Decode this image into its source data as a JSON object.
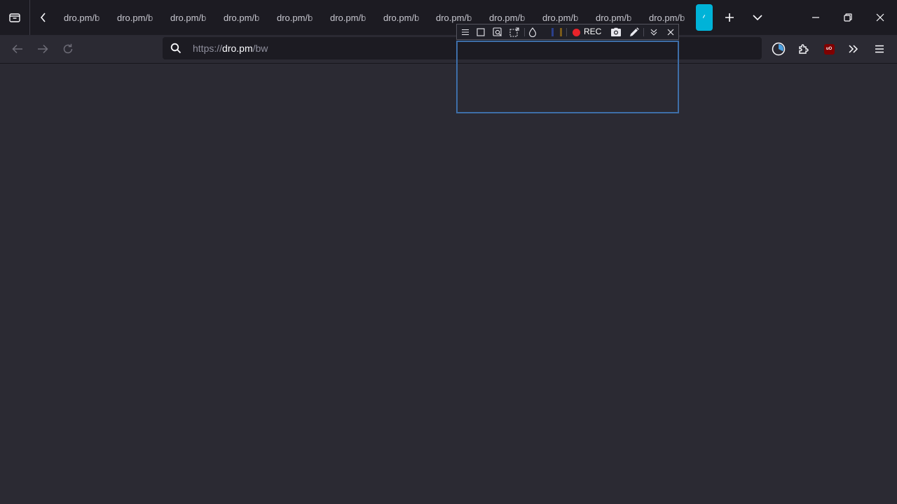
{
  "tabs": [
    {
      "label": "dro.pm/b"
    },
    {
      "label": "dro.pm/b"
    },
    {
      "label": "dro.pm/b"
    },
    {
      "label": "dro.pm/b"
    },
    {
      "label": "dro.pm/b"
    },
    {
      "label": "dro.pm/b"
    },
    {
      "label": "dro.pm/b"
    },
    {
      "label": "dro.pm/b"
    },
    {
      "label": "dro.pm/b"
    },
    {
      "label": "dro.pm/b"
    },
    {
      "label": "dro.pm/b"
    },
    {
      "label": "dro.pm/b"
    }
  ],
  "urlbar": {
    "scheme": "https://",
    "host": "dro.pm",
    "path": "/bw"
  },
  "extensions": {
    "ublock_badge": "uO"
  },
  "capture_toolbar": {
    "rec_label": "REC",
    "rec_color": "#e8232a",
    "swatches": [
      "#2a3f8a",
      "#7a5a1a"
    ]
  },
  "colors": {
    "accent": "#00b3d8",
    "capture_border": "#3e6ea8",
    "background": "#2b2a33",
    "tabbar": "#1c1b22"
  },
  "icons": {
    "tab_list": "tab-list-icon",
    "scroll_left": "chevron-left-icon",
    "new_tab": "plus-icon",
    "all_tabs": "chevron-down-icon",
    "minimize": "minimize-icon",
    "restore": "restore-icon",
    "close": "close-icon",
    "back": "arrow-left-icon",
    "forward": "arrow-right-icon",
    "reload": "reload-icon",
    "search": "search-icon",
    "extension1": "pie-chart-icon",
    "extensions": "puzzle-icon",
    "overflow": "double-chevron-right-icon",
    "menu": "hamburger-icon"
  }
}
